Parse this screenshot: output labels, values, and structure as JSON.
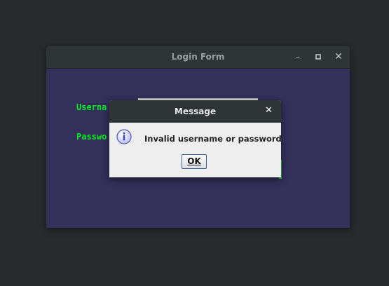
{
  "window": {
    "title": "Login Form",
    "minimize_glyph": "–",
    "maximize_glyph": "▫",
    "close_glyph": "✕"
  },
  "form": {
    "username_label": "Userna",
    "password_label": "Passwo"
  },
  "dialog": {
    "title": "Message",
    "close_glyph": "✕",
    "icon": "info-icon",
    "message": "Invalid username or password",
    "ok_label": "OK"
  },
  "colors": {
    "desktop_bg": "#272b2d",
    "window_bg": "#33305a",
    "label_green": "#00ef1c",
    "dialog_bg": "#eeeeee",
    "titlebar_bg": "#2f3436"
  }
}
